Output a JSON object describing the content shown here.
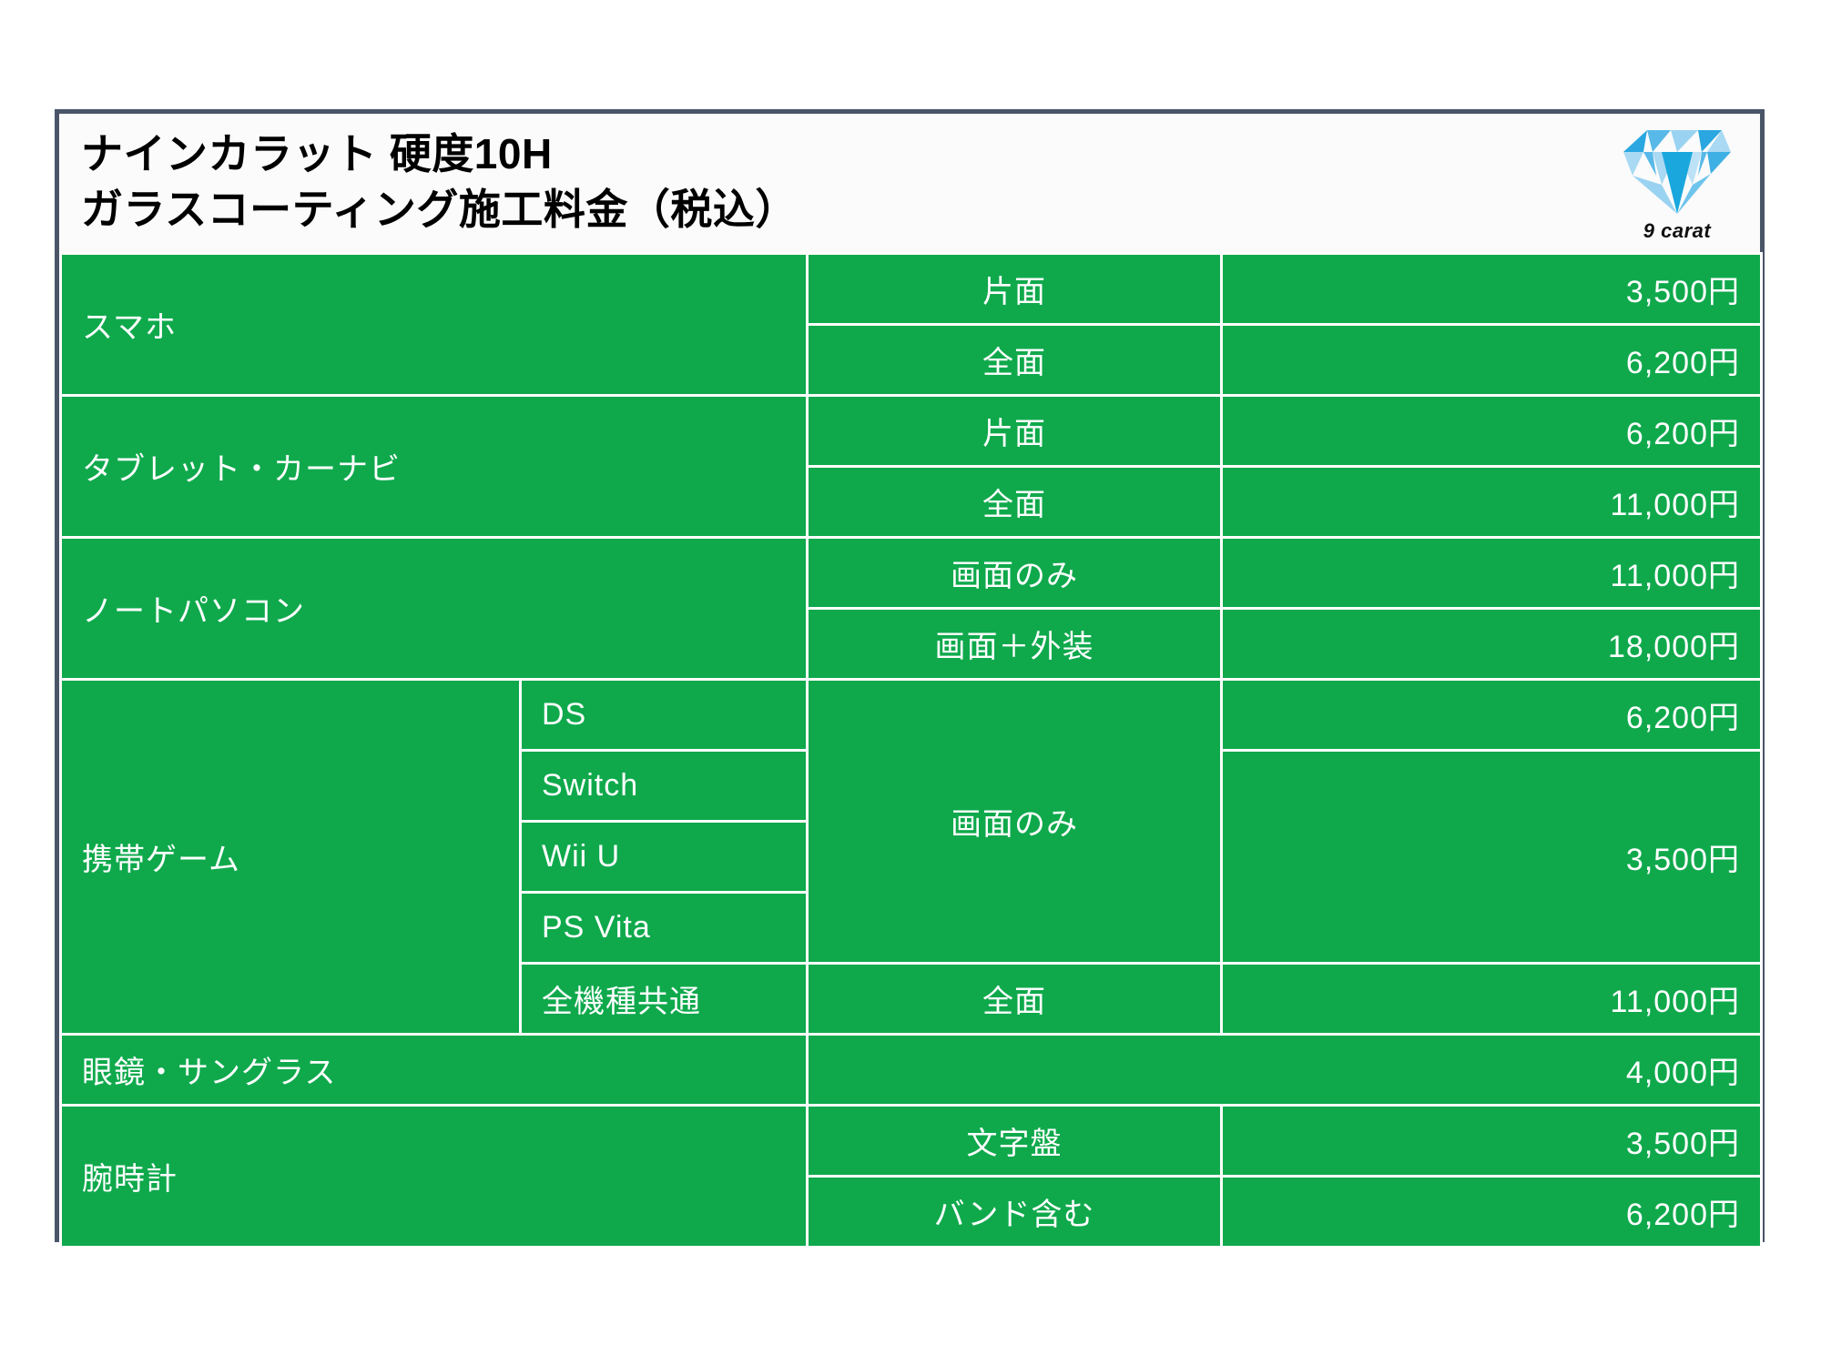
{
  "header": {
    "title_line1": "ナインカラット 硬度10H",
    "title_line2": "ガラスコーティング施工料金（税込）",
    "logo_text": "9 carat",
    "logo_icon": "diamond-icon"
  },
  "currency_suffix": "円",
  "table": {
    "rows": [
      {
        "category": "スマホ",
        "subtype": "",
        "option": "片面",
        "price": "3,500円"
      },
      {
        "category": "",
        "subtype": "",
        "option": "全面",
        "price": "6,200円"
      },
      {
        "category": "タブレット・カーナビ",
        "subtype": "",
        "option": "片面",
        "price": "6,200円"
      },
      {
        "category": "",
        "subtype": "",
        "option": "全面",
        "price": "11,000円"
      },
      {
        "category": "ノートパソコン",
        "subtype": "",
        "option": "画面のみ",
        "price": "11,000円"
      },
      {
        "category": "",
        "subtype": "",
        "option": "画面＋外装",
        "price": "18,000円"
      },
      {
        "category": "携帯ゲーム",
        "subtype": "DS",
        "option": "画面のみ",
        "price": "6,200円"
      },
      {
        "category": "",
        "subtype": "Switch",
        "option": "",
        "price": "3,500円"
      },
      {
        "category": "",
        "subtype": "Wii U",
        "option": "",
        "price": ""
      },
      {
        "category": "",
        "subtype": "PS Vita",
        "option": "",
        "price": ""
      },
      {
        "category": "",
        "subtype": "全機種共通",
        "option": "全面",
        "price": "11,000円"
      },
      {
        "category": "眼鏡・サングラス",
        "subtype": "",
        "option": "",
        "price": "4,000円"
      },
      {
        "category": "腕時計",
        "subtype": "",
        "option": "文字盤",
        "price": "3,500円"
      },
      {
        "category": "",
        "subtype": "",
        "option": "バンド含む",
        "price": "6,200円"
      }
    ]
  },
  "colors": {
    "cell_green": "#0fa94c",
    "border_outer": "#4a5568",
    "grid_white": "#ffffff",
    "logo_blue_dark": "#1d9bd7",
    "logo_blue_mid": "#58b9e8",
    "logo_blue_light": "#a9d9f3"
  }
}
